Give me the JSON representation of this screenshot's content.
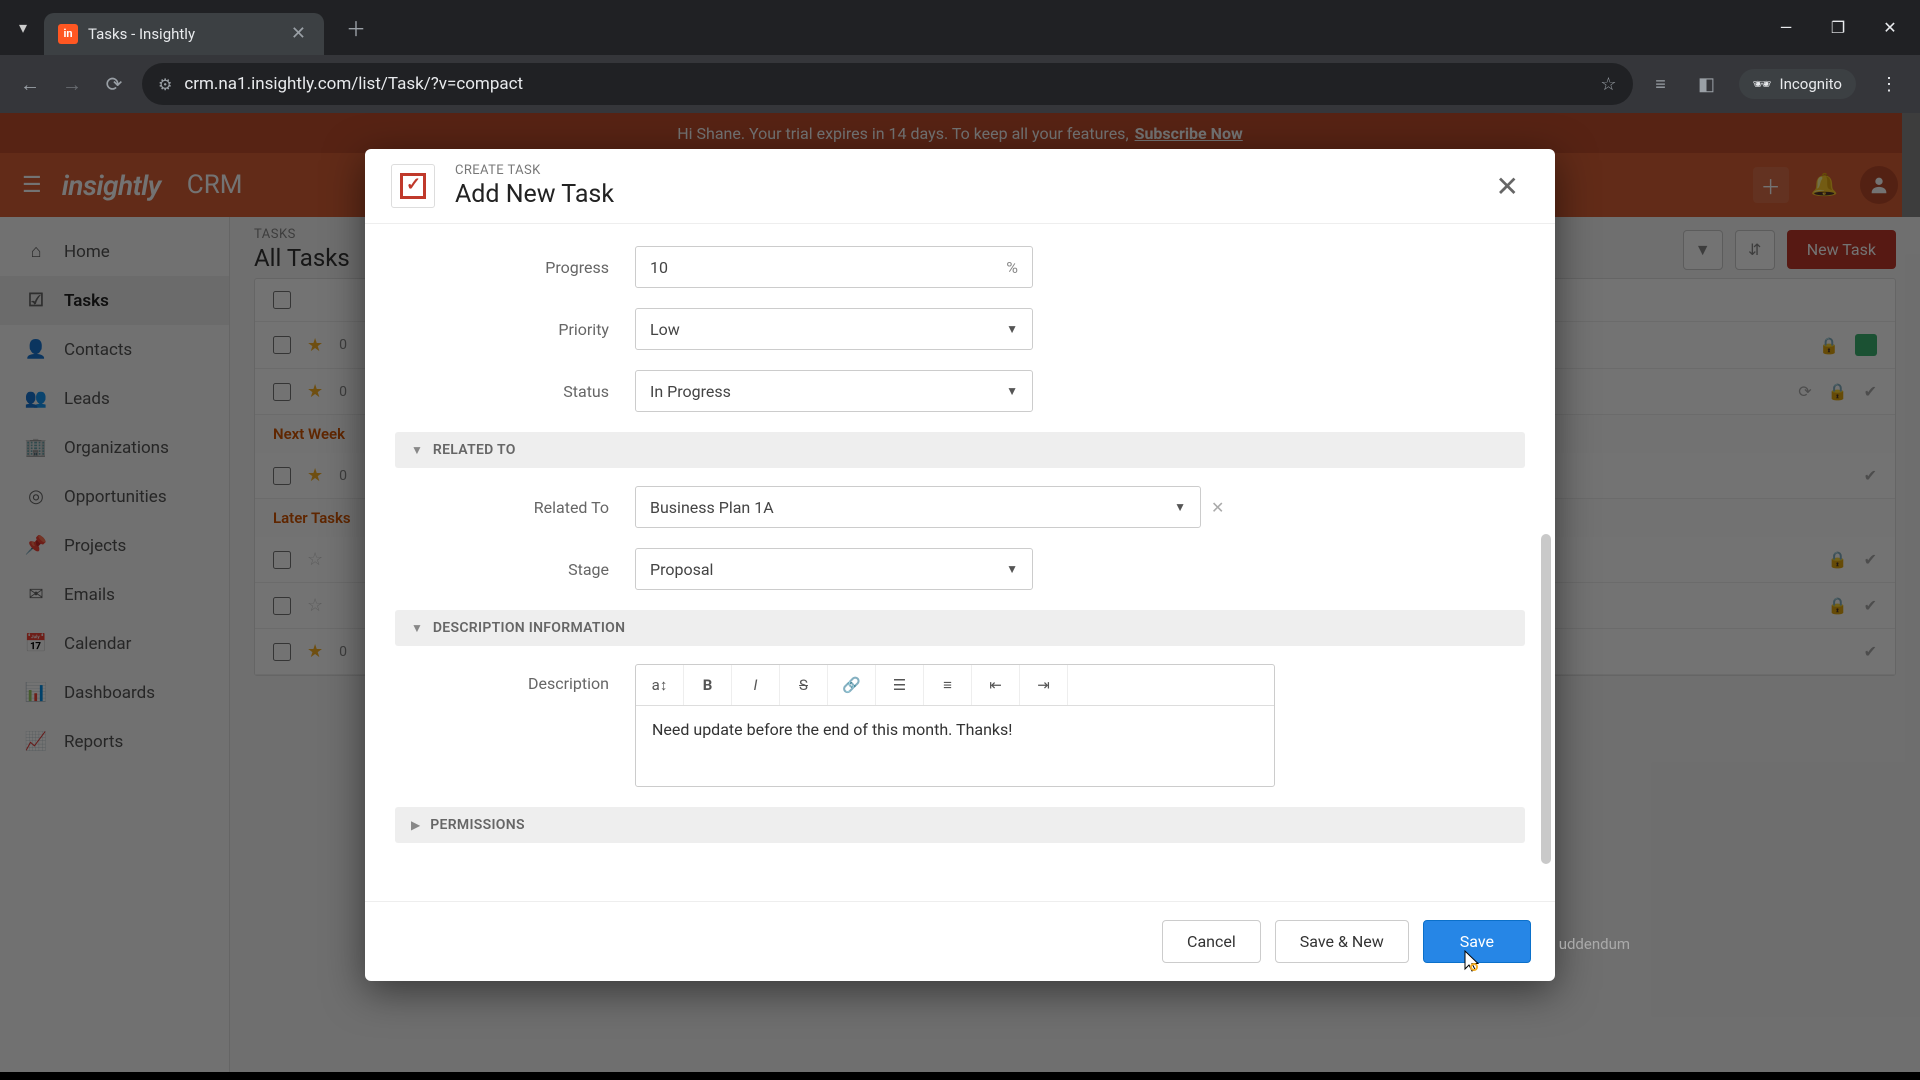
{
  "browser": {
    "tab_title": "Tasks - Insightly",
    "url": "crm.na1.insightly.com/list/Task/?v=compact",
    "incognito_label": "Incognito"
  },
  "trial": {
    "greeting": "Hi Shane. Your trial expires in 14 days. To keep all your features,",
    "link": "Subscribe Now"
  },
  "appHeader": {
    "logo": "insightly",
    "product": "CRM"
  },
  "sidebar": {
    "items": [
      {
        "label": "Home",
        "icon": "⌂"
      },
      {
        "label": "Tasks",
        "icon": "☑"
      },
      {
        "label": "Contacts",
        "icon": "👤"
      },
      {
        "label": "Leads",
        "icon": "👥"
      },
      {
        "label": "Organizations",
        "icon": "🏢"
      },
      {
        "label": "Opportunities",
        "icon": "◎"
      },
      {
        "label": "Projects",
        "icon": "📌"
      },
      {
        "label": "Emails",
        "icon": "✉"
      },
      {
        "label": "Calendar",
        "icon": "📅"
      },
      {
        "label": "Dashboards",
        "icon": "📊"
      },
      {
        "label": "Reports",
        "icon": "📈"
      }
    ],
    "active_index": 1
  },
  "main": {
    "breadcrumb": "TASKS",
    "title": "All Tasks",
    "new_task_button": "New Task",
    "groups": {
      "next_week": "Next Week",
      "later": "Later Tasks"
    }
  },
  "modal": {
    "eyebrow": "CREATE TASK",
    "title": "Add New Task",
    "fields": {
      "progress_label": "Progress",
      "progress_value": "10",
      "progress_suffix": "%",
      "priority_label": "Priority",
      "priority_value": "Low",
      "status_label": "Status",
      "status_value": "In Progress",
      "related_to_label": "Related To",
      "related_to_value": "Business Plan 1A",
      "stage_label": "Stage",
      "stage_value": "Proposal",
      "description_label": "Description",
      "description_value": "Need update before the end of this month. Thanks!"
    },
    "sections": {
      "related_to": "RELATED TO",
      "description_info": "DESCRIPTION INFORMATION",
      "permissions": "PERMISSIONS"
    },
    "buttons": {
      "cancel": "Cancel",
      "save_new": "Save & New",
      "save": "Save"
    },
    "ghost_footer": "uddendum"
  }
}
